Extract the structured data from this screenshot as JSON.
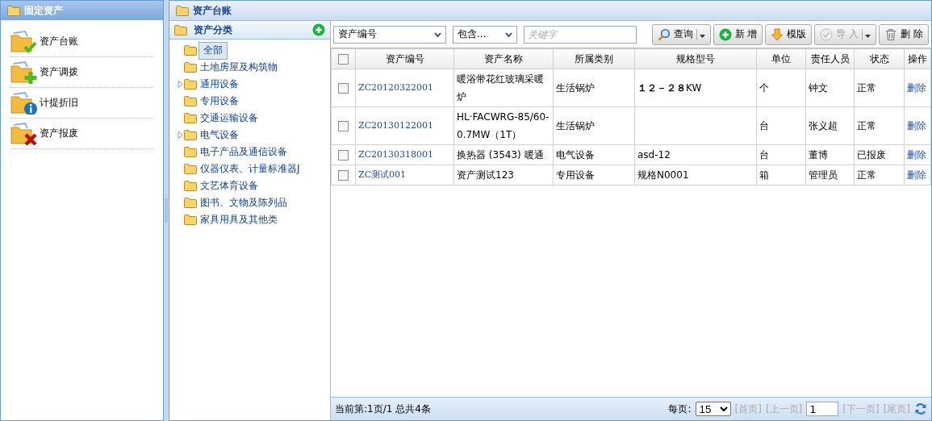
{
  "left_panel": {
    "title": "固定资产",
    "menu": [
      {
        "label": "资产台账",
        "kind": "check"
      },
      {
        "label": "资产调拨",
        "kind": "plus"
      },
      {
        "label": "计提折旧",
        "kind": "info"
      },
      {
        "label": "资产报废",
        "kind": "cross"
      }
    ]
  },
  "main_panel": {
    "title": "资产台账",
    "tree": {
      "title": "资产分类",
      "items": [
        {
          "label": "全部",
          "selected": true
        },
        {
          "label": "土地房屋及构筑物",
          "selected": false
        },
        {
          "label": "通用设备",
          "selected": false,
          "expanded": false
        },
        {
          "label": "专用设备",
          "selected": false
        },
        {
          "label": "交通运输设备",
          "selected": false
        },
        {
          "label": "电气设备",
          "selected": false,
          "expanded": false
        },
        {
          "label": "电子产品及通信设备",
          "selected": false
        },
        {
          "label": "仪器仪表、计量标准器J",
          "selected": false
        },
        {
          "label": "文艺体育设备",
          "selected": false
        },
        {
          "label": "图书、文物及陈列品",
          "selected": false
        },
        {
          "label": "家具用具及其他类",
          "selected": false
        }
      ]
    },
    "toolbar": {
      "field_select": "资产编号",
      "match_select": "包含...",
      "keyword": {
        "placeholder": "关键字"
      },
      "buttons": [
        {
          "label": "查询",
          "kind": "search",
          "dropdown": true,
          "disabled": false
        },
        {
          "label": "新 增",
          "kind": "add",
          "dropdown": false,
          "disabled": false
        },
        {
          "label": "模版",
          "kind": "download",
          "dropdown": false,
          "disabled": false
        },
        {
          "label": "导 入",
          "kind": "import",
          "dropdown": true,
          "disabled": true
        },
        {
          "label": "删 除",
          "kind": "delete",
          "dropdown": false,
          "disabled": false
        }
      ]
    },
    "table": {
      "select_all_checked": false,
      "columns": [
        "资产编号",
        "资产名称",
        "所属类别",
        "规格型号",
        "单位",
        "责任人员",
        "状态",
        "操作"
      ],
      "rows": [
        {
          "checked": false,
          "code": "ZC20120322001",
          "name": "暖浴带花红玻璃采暖炉",
          "category": "生活锅炉",
          "spec": "**１２－２８**KW",
          "unit": "个",
          "owner": "钟文",
          "status": "正常",
          "action": "删除"
        },
        {
          "checked": false,
          "code": "ZC20130122001",
          "name": "HL·FACWRG-85/60-0.7MW（1T）",
          "category": "生活锅炉",
          "spec": "",
          "unit": "台",
          "owner": "张义超",
          "status": "正常",
          "action": "删除"
        },
        {
          "checked": false,
          "code": "ZC20130318001",
          "name": "换热器 (3543) 暖通",
          "category": "电气设备",
          "spec": "asd-12",
          "unit": "台",
          "owner": "董博",
          "status": "已报废",
          "action": "删除"
        },
        {
          "checked": false,
          "code": "ZC测试001",
          "name": "资产测试123",
          "category": "专用设备",
          "spec": "规格N0001",
          "unit": "箱",
          "owner": "管理员",
          "status": "正常",
          "action": "删除"
        }
      ]
    },
    "pager": {
      "summary": "当前第:1页/1 总共4条",
      "per_page_label": "每页:",
      "per_page": "15",
      "links": [
        {
          "label": "[首页]",
          "disabled": true
        },
        {
          "label": "[上一页]",
          "disabled": true
        },
        {
          "label": "[下一页]",
          "disabled": true
        },
        {
          "label": "[尾页]",
          "disabled": true
        }
      ],
      "page": "1"
    }
  }
}
